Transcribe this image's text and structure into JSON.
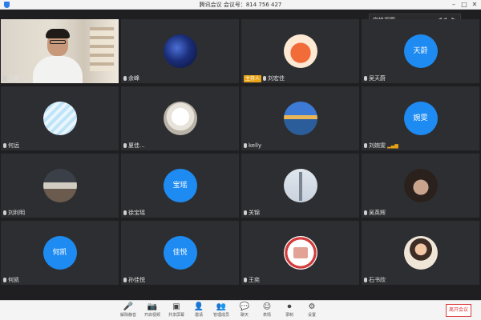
{
  "window": {
    "title": "腾讯会议 会议号：814 756 427"
  },
  "gallery_header": {
    "label": "宫格视图",
    "prev": "◀◀",
    "next": "▶"
  },
  "participants": [
    {
      "name": "吕鹏飞",
      "kind": "video"
    },
    {
      "name": "余峰",
      "avatar": "galaxy"
    },
    {
      "name": "刘宏佳",
      "avatar": "fox",
      "badge": "主持人"
    },
    {
      "name": "吴天蔚",
      "avatar_text": "天蔚"
    },
    {
      "name": "何远",
      "avatar": "sketch"
    },
    {
      "name": "夏佳...",
      "avatar": "dog"
    },
    {
      "name": "kelly",
      "avatar": "lake"
    },
    {
      "name": "刘婉雯",
      "avatar_text": "婉雯",
      "signal": "▂▄▆"
    },
    {
      "name": "刘利明",
      "avatar": "people"
    },
    {
      "name": "徐宝瑶",
      "avatar_text": "宝瑶"
    },
    {
      "name": "关锦",
      "avatar": "tower"
    },
    {
      "name": "吴英辉",
      "avatar": "face"
    },
    {
      "name": "何凯",
      "avatar_text": "何凯"
    },
    {
      "name": "孙佳悦",
      "avatar_text": "佳悦"
    },
    {
      "name": "王奕",
      "avatar": "stamp"
    },
    {
      "name": "石书欣",
      "avatar": "girl"
    }
  ],
  "toolbar": {
    "items": [
      {
        "icon": "🎤",
        "label": "解除静音",
        "red": true
      },
      {
        "icon": "📷",
        "label": "开启视频",
        "red": true
      },
      {
        "icon": "▣",
        "label": "共享屏幕"
      },
      {
        "icon": "👤",
        "label": "邀请"
      },
      {
        "icon": "👥",
        "label": "管理成员"
      },
      {
        "icon": "💬",
        "label": "聊天"
      },
      {
        "icon": "☺",
        "label": "表情"
      },
      {
        "icon": "⏺",
        "label": "录制"
      },
      {
        "icon": "⚙",
        "label": "设置"
      }
    ],
    "leave_label": "离开会议"
  }
}
